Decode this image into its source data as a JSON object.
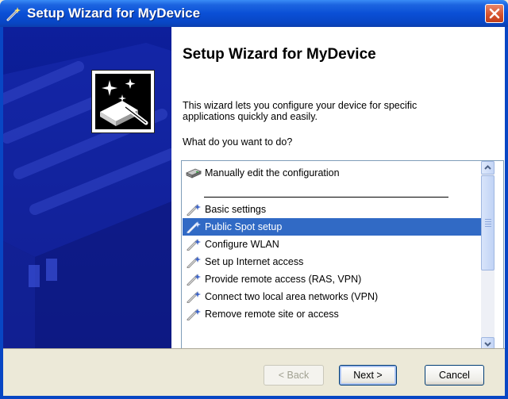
{
  "window": {
    "title": "Setup Wizard for MyDevice",
    "accent_color": "#0846c4",
    "close_icon": "close-icon"
  },
  "content": {
    "heading": "Setup Wizard for MyDevice",
    "description": "This wizard lets you configure your device for specific applications quickly and easily.",
    "question": "What do you want to do?"
  },
  "list": {
    "selected_index": 2,
    "selection_color": "#316ac5",
    "items": [
      {
        "label": "Manually edit the configuration",
        "icon": "device-icon"
      },
      {
        "label": "Basic settings",
        "icon": "wand-icon"
      },
      {
        "label": "Public Spot setup",
        "icon": "wand-icon"
      },
      {
        "label": "Configure WLAN",
        "icon": "wand-icon"
      },
      {
        "label": "Set up Internet access",
        "icon": "wand-icon"
      },
      {
        "label": "Provide remote access (RAS, VPN)",
        "icon": "wand-icon"
      },
      {
        "label": "Connect two local area networks (VPN)",
        "icon": "wand-icon"
      },
      {
        "label": "Remove remote site or access",
        "icon": "wand-icon"
      }
    ]
  },
  "buttons": {
    "back": "< Back",
    "next": "Next >",
    "cancel": "Cancel"
  }
}
